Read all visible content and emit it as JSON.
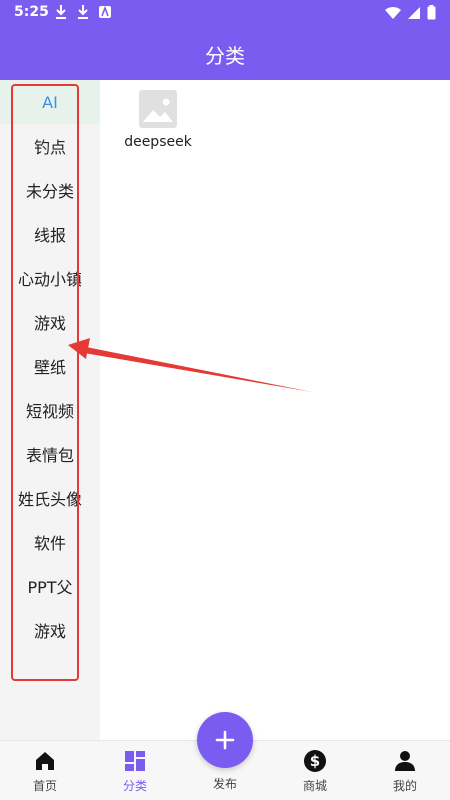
{
  "status_bar": {
    "time": "5:25",
    "left_icons": [
      "download-icon",
      "download-icon",
      "app-icon"
    ],
    "right_icons": [
      "wifi-icon",
      "signal-icon",
      "battery-icon"
    ]
  },
  "app_bar": {
    "title": "分类"
  },
  "sidebar": {
    "items": [
      {
        "label": "AI",
        "active": true
      },
      {
        "label": "钓点"
      },
      {
        "label": "未分类"
      },
      {
        "label": "线报"
      },
      {
        "label": "心动小镇"
      },
      {
        "label": "游戏"
      },
      {
        "label": "壁纸"
      },
      {
        "label": "短视频"
      },
      {
        "label": "表情包"
      },
      {
        "label": "姓氏头像"
      },
      {
        "label": "软件"
      },
      {
        "label": "PPT父"
      },
      {
        "label": "游戏"
      }
    ]
  },
  "content": {
    "items": [
      {
        "label": "deepseek",
        "icon": "image-placeholder-icon"
      }
    ]
  },
  "bottom_nav": {
    "items": [
      {
        "label": "首页",
        "icon": "home-icon"
      },
      {
        "label": "分类",
        "icon": "category-icon",
        "active": true
      },
      {
        "label": "发布",
        "icon": "plus-icon"
      },
      {
        "label": "商城",
        "icon": "dollar-icon"
      },
      {
        "label": "我的",
        "icon": "user-icon"
      }
    ]
  },
  "colors": {
    "primary": "#7b5cf0",
    "active_text": "#3b8fe6",
    "highlight_red": "#e53935"
  }
}
